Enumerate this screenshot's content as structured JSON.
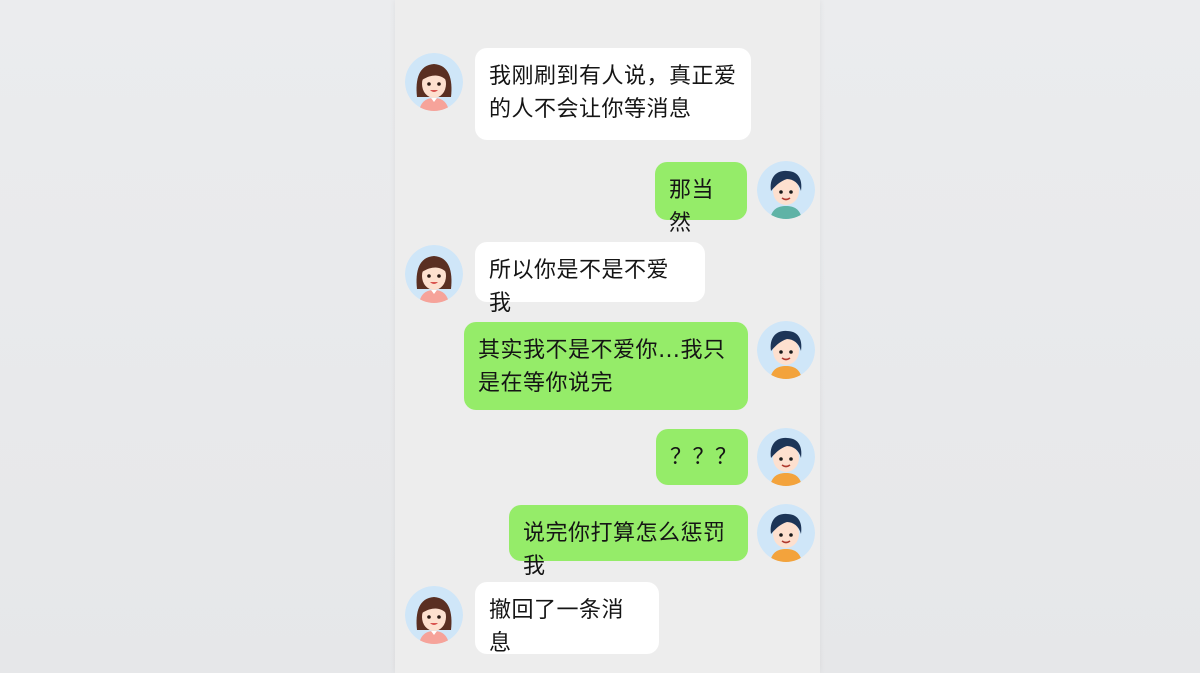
{
  "chat": {
    "messages": [
      {
        "side": "left",
        "avatar": "girl-avatar-icon",
        "text": "我刚刷到有人说，真正爱的人不会让你等消息"
      },
      {
        "side": "right",
        "avatar": "boy-avatar-icon",
        "text": "那当然"
      },
      {
        "side": "left",
        "avatar": "girl-avatar-icon",
        "text": "所以你是不是不爱我"
      },
      {
        "side": "right",
        "avatar": "boy-avatar-icon",
        "text": "其实我不是不爱你…我只是在等你说完"
      },
      {
        "side": "right",
        "avatar": "boy-avatar-icon",
        "text": "？？？"
      },
      {
        "side": "right",
        "avatar": "boy-avatar-icon",
        "text": "说完你打算怎么惩罚我"
      },
      {
        "side": "left",
        "avatar": "girl-avatar-icon",
        "text": "撤回了一条消息"
      }
    ]
  },
  "colors": {
    "left_bubble": "#ffffff",
    "right_bubble": "#95ec69",
    "chat_background": "#ededed"
  }
}
